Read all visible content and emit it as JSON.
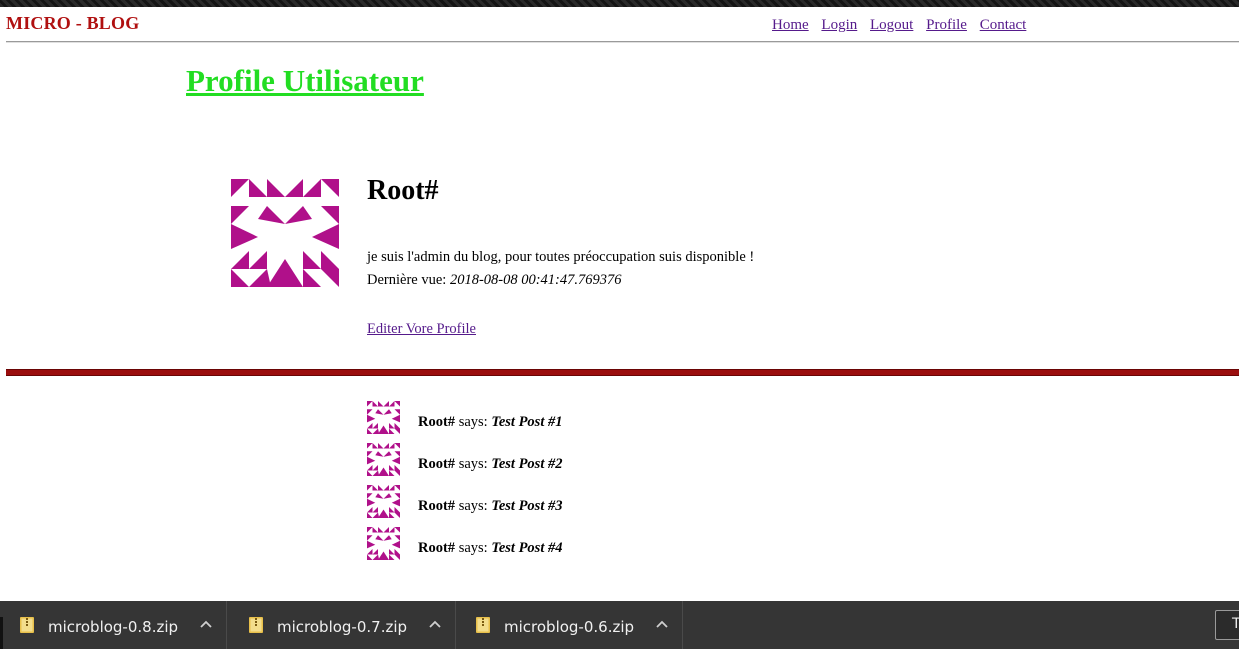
{
  "header": {
    "brand": "MICRO - BLOG",
    "nav": [
      "Home",
      "Login",
      "Logout",
      "Profile",
      "Contact"
    ]
  },
  "page": {
    "title": "Profile Utilisateur"
  },
  "profile": {
    "username": "Root#",
    "about": "je suis l'admin du blog, pour toutes préoccupation suis disponible !",
    "last_seen_label": "Dernière vue:",
    "last_seen_value": "2018-08-08 00:41:47.769376",
    "edit_link": "Editer Vore Profile"
  },
  "posts": [
    {
      "author": "Root#",
      "says": "says:",
      "body": "Test Post #1"
    },
    {
      "author": "Root#",
      "says": "says:",
      "body": "Test Post #2"
    },
    {
      "author": "Root#",
      "says": "says:",
      "body": "Test Post #3"
    },
    {
      "author": "Root#",
      "says": "says:",
      "body": "Test Post #4"
    }
  ],
  "downloads": {
    "items": [
      "microblog-0.8.zip",
      "microblog-0.7.zip",
      "microblog-0.6.zip"
    ],
    "button_text": "T"
  },
  "colors": {
    "brand": "#b01010",
    "title": "#22dd22",
    "link": "#551a8b",
    "avatar": "#b0108a",
    "divider": "#9b0e0e",
    "download_bar": "#353535"
  },
  "icons": {
    "avatar": "identicon-avatar",
    "download": "zip-file-icon",
    "chevron": "chevron-up-icon"
  }
}
